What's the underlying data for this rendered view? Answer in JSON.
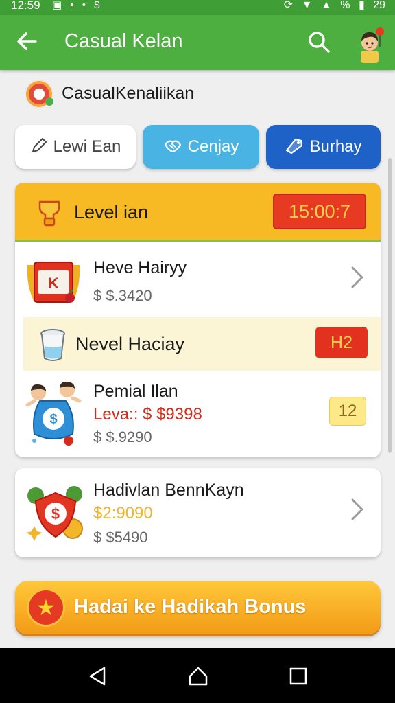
{
  "status_bar": {
    "time": "12:59",
    "left_icons": "▣ • • $",
    "right_icons": [
      "⟳",
      "▼",
      "▲"
    ],
    "battery": "29",
    "percent": "%"
  },
  "app_bar": {
    "title": "Casual Kelan",
    "back_icon": "arrow-left-icon",
    "search_icon": "search-icon"
  },
  "app_name": "CasualKenaliikan",
  "tabs": [
    {
      "label": "Lewi Ean",
      "icon": "pencil-icon"
    },
    {
      "label": "Cenjay",
      "icon": "handshake-icon"
    },
    {
      "label": "Burhay",
      "icon": "tag-icon"
    }
  ],
  "level_card": {
    "title": "Level ian",
    "timer": "15:00:7",
    "item1": {
      "name": "Heve Hairyy",
      "price": "$ $.3420"
    },
    "section": {
      "title": "Nevel Haciay",
      "badge": "H2"
    },
    "item2": {
      "name": "Pemial Ilan",
      "promo": "Leva:: $ $9398",
      "price": "$ $.9290",
      "qty": "12"
    }
  },
  "card2": {
    "name": "Hadivlan BennKayn",
    "promo": "$2:9090",
    "price": "$ $5490"
  },
  "bonus_button": {
    "label": "Hadai ke Hadikah Bonus",
    "icon": "star-icon"
  },
  "colors": {
    "appbar": "#4caf3f",
    "accent_yellow": "#f7b924",
    "timer_red": "#e63a23",
    "tab_blue": "#1e62c8",
    "tab_light_blue": "#49b3e4"
  }
}
